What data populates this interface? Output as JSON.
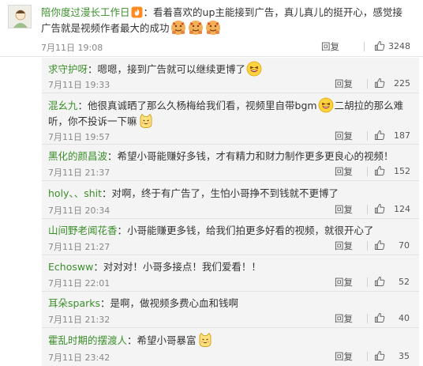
{
  "main_comment": {
    "user": "陪你度过漫长工作日",
    "text": "：看着喜欢的up主能接到广告，真儿真儿的挺开心，感觉接广告就是视频作者最大的成功",
    "time": "7月11日 19:08",
    "reply_label": "回复",
    "likes": "3248",
    "user_badge_icon": "fire-badge-icon",
    "emojis": [
      "fist-emoji-icon",
      "fist-emoji-icon",
      "fist-emoji-icon"
    ]
  },
  "replies": [
    {
      "user": "求守护呀",
      "text": "：嗯嗯，接到广告就可以继续更博了",
      "time": "7月11日 19:33",
      "reply_label": "回复",
      "likes": "225",
      "emoji": "laughing-emoji-icon"
    },
    {
      "user": "混幺九",
      "text_a": "：他很真诚晒了那么久杨梅给我们看，视频里自带bgm",
      "text_b": "二胡拉的那么难听，你不投诉一下嘛",
      "time": "7月11日 19:57",
      "reply_label": "回复",
      "likes": "187",
      "emoji_a": "laughing-emoji-icon",
      "emoji_b": "cat-emoji-icon"
    },
    {
      "user": "黑化的颜昌波",
      "text": "：希望小哥能赚好多钱，才有精力和财力制作更多更良心的视频！",
      "time": "7月11日 21:37",
      "reply_label": "回复",
      "likes": "152"
    },
    {
      "user": "holy、、shit",
      "text": "：对啊，终于有广告了，生怕小哥挣不到钱就不更博了",
      "time": "7月11日 20:34",
      "reply_label": "回复",
      "likes": "124"
    },
    {
      "user": "山间野老闻花香",
      "text": "：小哥能赚更多钱，给我们拍更多好看的视频，就很开心了",
      "time": "7月11日 21:27",
      "reply_label": "回复",
      "likes": "70"
    },
    {
      "user": "Echosww",
      "text": "：对对对！小哥多接点！我们爱看！！",
      "time": "7月11日 22:01",
      "reply_label": "回复",
      "likes": "52"
    },
    {
      "user": "耳朵sparks",
      "text": "：是啊，做视频多费心血和钱啊",
      "time": "7月11日 21:32",
      "reply_label": "回复",
      "likes": "40"
    },
    {
      "user": "霍乱时期的摆渡人",
      "text": "：希望小哥暴富",
      "time": "7月11日 23:42",
      "reply_label": "回复",
      "likes": "35",
      "emoji": "cat-emoji-icon"
    }
  ],
  "colors": {
    "username": "#3b8f2a",
    "text": "#333333",
    "meta": "#888888",
    "reply_bg": "#f4f4f4"
  }
}
